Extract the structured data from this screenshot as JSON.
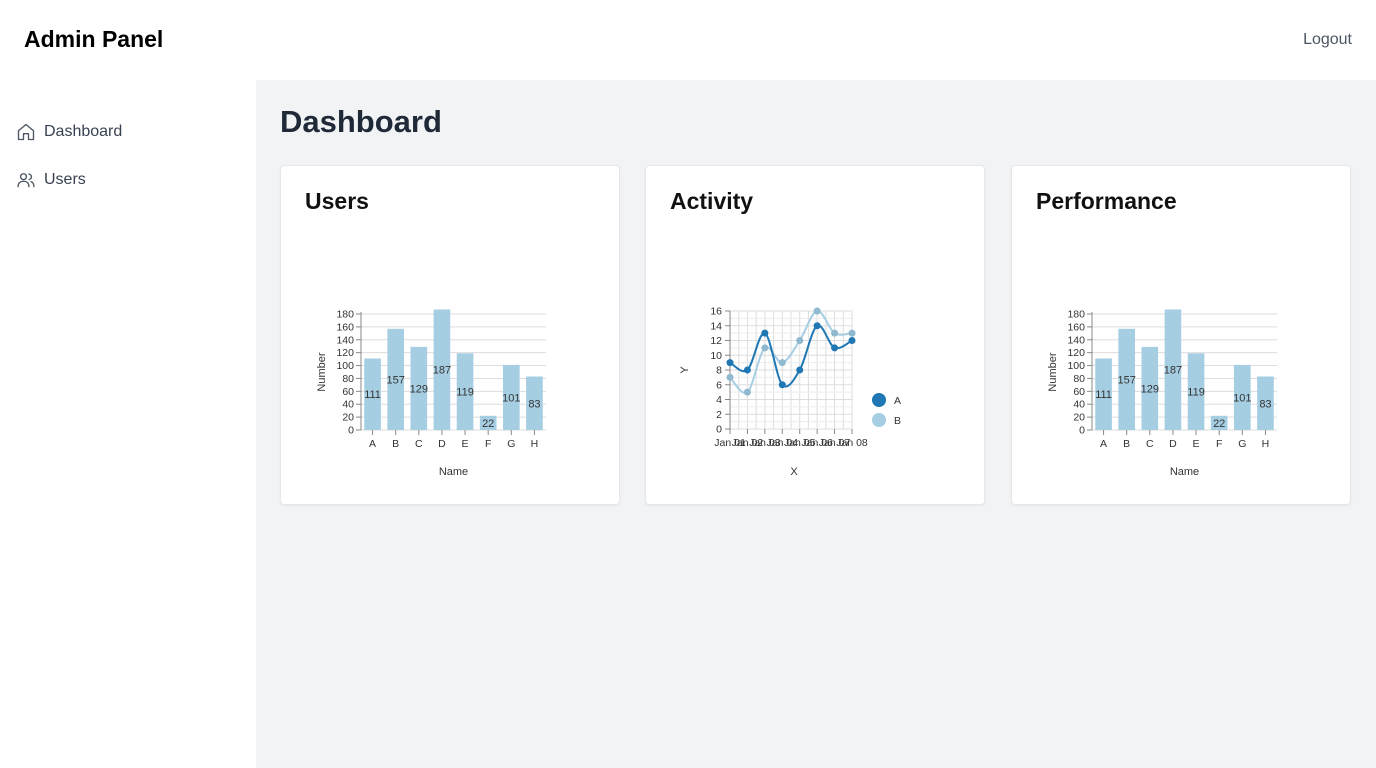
{
  "header": {
    "brand": "Admin Panel",
    "logout_label": "Logout"
  },
  "sidebar": {
    "items": [
      {
        "label": "Dashboard",
        "icon": "home-icon"
      },
      {
        "label": "Users",
        "icon": "users-icon"
      }
    ]
  },
  "main": {
    "title": "Dashboard",
    "cards": [
      {
        "title": "Users"
      },
      {
        "title": "Activity"
      },
      {
        "title": "Performance"
      }
    ]
  },
  "colors": {
    "bar": "#a6cee3",
    "series_a": "#1f78b4",
    "series_b": "#a6cee3",
    "grid": "#dddddd",
    "page_bg": "#f2f3f5"
  },
  "chart_data": [
    {
      "type": "bar",
      "categories": [
        "A",
        "B",
        "C",
        "D",
        "E",
        "F",
        "G",
        "H"
      ],
      "values": [
        111,
        157,
        129,
        187,
        119,
        22,
        101,
        83
      ],
      "yticks": [
        0,
        20,
        40,
        60,
        80,
        100,
        120,
        140,
        160,
        180
      ],
      "ylim": [
        0,
        180
      ],
      "xlabel": "Name",
      "ylabel": "Number",
      "grid": true
    },
    {
      "type": "line",
      "x": [
        "Jan 01",
        "Jan 02",
        "Jan 03",
        "Jan 04",
        "Jan 05",
        "Jan 06",
        "Jan 07",
        "Jan 08"
      ],
      "xtick_labels": [
        "Jan 01",
        "Jan 02",
        "Jan 03",
        "Jan 04",
        "Jan 05",
        "Jan 06",
        "Jan 07",
        "Jan 08"
      ],
      "series": [
        {
          "name": "A",
          "values": [
            9,
            8,
            13,
            6,
            8,
            14,
            11,
            12
          ]
        },
        {
          "name": "B",
          "values": [
            7,
            5,
            11,
            9,
            12,
            16,
            13,
            13
          ]
        }
      ],
      "yticks": [
        0,
        2,
        4,
        6,
        8,
        10,
        12,
        14,
        16
      ],
      "ylim": [
        0,
        16
      ],
      "xlabel": "X",
      "ylabel": "Y",
      "legend": "right",
      "grid": true
    },
    {
      "type": "bar",
      "categories": [
        "A",
        "B",
        "C",
        "D",
        "E",
        "F",
        "G",
        "H"
      ],
      "values": [
        111,
        157,
        129,
        187,
        119,
        22,
        101,
        83
      ],
      "yticks": [
        0,
        20,
        40,
        60,
        80,
        100,
        120,
        140,
        160,
        180
      ],
      "ylim": [
        0,
        180
      ],
      "xlabel": "Name",
      "ylabel": "Number",
      "grid": true
    }
  ]
}
